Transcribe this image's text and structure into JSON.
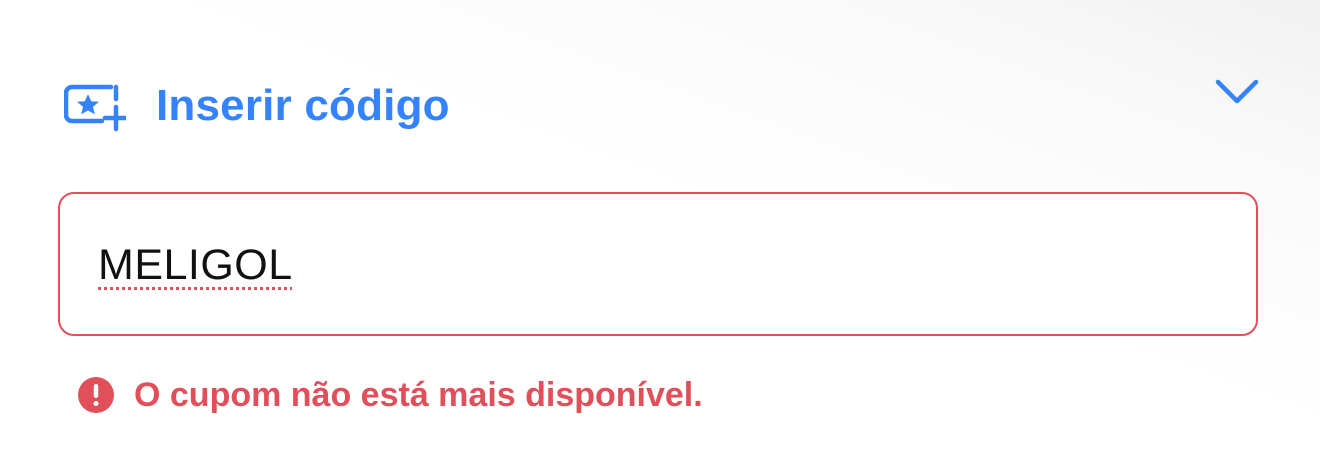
{
  "coupon": {
    "title": "Inserir código",
    "title_icon": "coupon-star-add-icon",
    "toggle_icon": "chevron-down-icon",
    "input_value": "MELIGOL",
    "error_icon": "error-exclamation-icon",
    "error_message": "O cupom não está mais disponível."
  },
  "colors": {
    "accent": "#3483fa",
    "error": "#e1505a",
    "text": "#111111"
  }
}
